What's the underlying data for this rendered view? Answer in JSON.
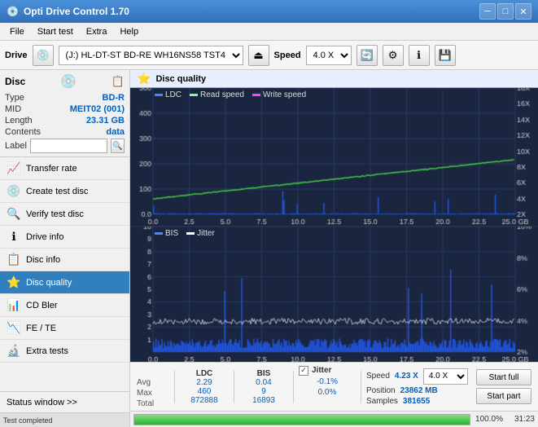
{
  "app": {
    "title": "Opti Drive Control 1.70",
    "icon": "💿"
  },
  "titlebar": {
    "minimize": "─",
    "maximize": "□",
    "close": "✕"
  },
  "menubar": {
    "items": [
      "File",
      "Start test",
      "Extra",
      "Help"
    ]
  },
  "toolbar": {
    "drive_label": "Drive",
    "drive_value": "(J:)  HL-DT-ST BD-RE  WH16NS58 TST4",
    "speed_label": "Speed",
    "speed_value": "4.0 X"
  },
  "disc_panel": {
    "title": "Disc",
    "type_label": "Type",
    "type_value": "BD-R",
    "mid_label": "MID",
    "mid_value": "MEIT02 (001)",
    "length_label": "Length",
    "length_value": "23.31 GB",
    "contents_label": "Contents",
    "contents_value": "data",
    "label_label": "Label",
    "label_placeholder": ""
  },
  "nav_items": [
    {
      "id": "transfer-rate",
      "label": "Transfer rate",
      "icon": "📈"
    },
    {
      "id": "create-test-disc",
      "label": "Create test disc",
      "icon": "💿"
    },
    {
      "id": "verify-test-disc",
      "label": "Verify test disc",
      "icon": "🔍"
    },
    {
      "id": "drive-info",
      "label": "Drive info",
      "icon": "ℹ"
    },
    {
      "id": "disc-info",
      "label": "Disc info",
      "icon": "📋"
    },
    {
      "id": "disc-quality",
      "label": "Disc quality",
      "icon": "⭐",
      "active": true
    },
    {
      "id": "cd-bler",
      "label": "CD Bler",
      "icon": "📊"
    },
    {
      "id": "fe-te",
      "label": "FE / TE",
      "icon": "📉"
    },
    {
      "id": "extra-tests",
      "label": "Extra tests",
      "icon": "🔬"
    }
  ],
  "status_window": "Status window >>",
  "disc_quality": {
    "title": "Disc quality",
    "legend": {
      "ldc_label": "LDC",
      "ldc_color": "#4488ff",
      "read_speed_label": "Read speed",
      "read_speed_color": "#88ff88",
      "write_speed_label": "Write speed",
      "write_speed_color": "#ff44ff"
    },
    "legend2": {
      "bis_label": "BIS",
      "bis_color": "#4488ff",
      "jitter_label": "Jitter",
      "jitter_color": "#ffffff"
    }
  },
  "chart_top": {
    "y_labels_left": [
      "500",
      "400",
      "300",
      "200",
      "100",
      "0.0"
    ],
    "y_labels_right": [
      "18X",
      "16X",
      "14X",
      "12X",
      "10X",
      "8X",
      "6X",
      "4X",
      "2X"
    ],
    "x_labels": [
      "0.0",
      "2.5",
      "5.0",
      "7.5",
      "10.0",
      "12.5",
      "15.0",
      "17.5",
      "20.0",
      "22.5",
      "25.0 GB"
    ]
  },
  "chart_bottom": {
    "y_labels_left": [
      "10",
      "9",
      "8",
      "7",
      "6",
      "5",
      "4",
      "3",
      "2",
      "1"
    ],
    "y_labels_right": [
      "10%",
      "8%",
      "6%",
      "4%",
      "2%"
    ],
    "x_labels": [
      "0.0",
      "2.5",
      "5.0",
      "7.5",
      "10.0",
      "12.5",
      "15.0",
      "17.5",
      "20.0",
      "22.5",
      "25.0 GB"
    ]
  },
  "stats": {
    "ldc_header": "LDC",
    "bis_header": "BIS",
    "jitter_header": "Jitter",
    "avg_label": "Avg",
    "max_label": "Max",
    "total_label": "Total",
    "avg_ldc": "2.29",
    "avg_bis": "0.04",
    "avg_jitter": "-0.1%",
    "max_ldc": "460",
    "max_bis": "9",
    "max_jitter": "0.0%",
    "total_ldc": "872888",
    "total_bis": "16893",
    "jitter_checked": true,
    "speed_label": "Speed",
    "speed_value": "4.23 X",
    "position_label": "Position",
    "position_value": "23862 MB",
    "samples_label": "Samples",
    "samples_value": "381655",
    "speed_select": "4.0 X",
    "start_full_label": "Start full",
    "start_part_label": "Start part"
  },
  "progress": {
    "percent": 100,
    "percent_text": "100.0%",
    "time": "31:23"
  },
  "status": {
    "text": "Test completed"
  }
}
